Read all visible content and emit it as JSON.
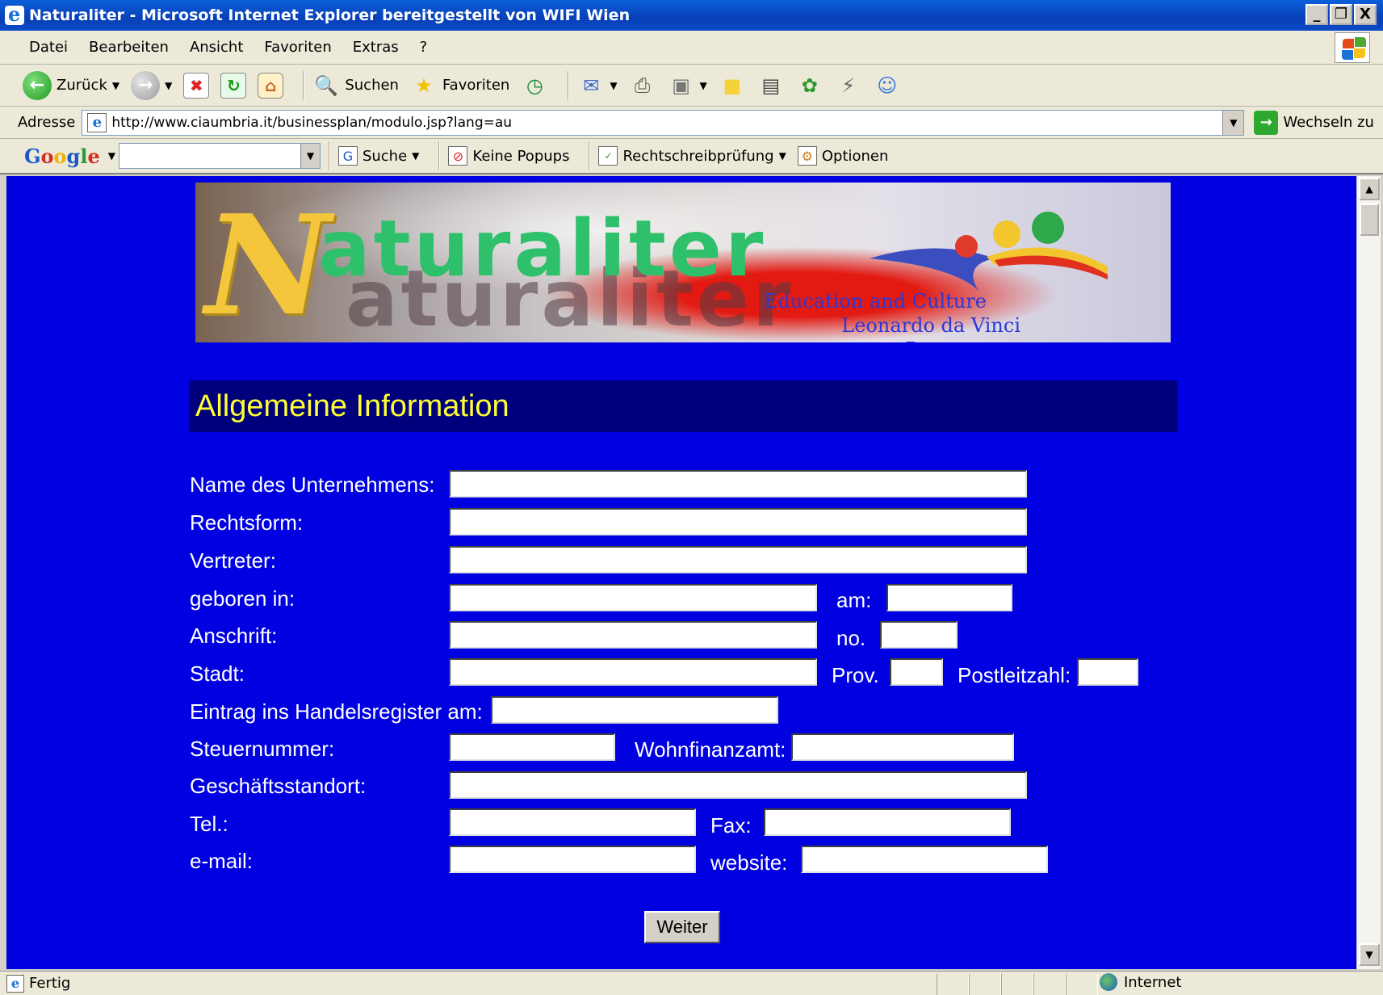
{
  "window": {
    "title": "Naturaliter - Microsoft Internet Explorer bereitgestellt von WIFI Wien",
    "buttons": [
      "_",
      "❐",
      "X"
    ]
  },
  "menu": [
    "Datei",
    "Bearbeiten",
    "Ansicht",
    "Favoriten",
    "Extras",
    "?"
  ],
  "toolbar": {
    "back_label": "Zurück",
    "search_label": "Suchen",
    "favorites_label": "Favoriten"
  },
  "address": {
    "label": "Adresse",
    "url": "http://www.ciaumbria.it/businessplan/modulo.jsp?lang=au",
    "go_label": "Wechseln zu"
  },
  "google_toolbar": {
    "logo": [
      "G",
      "o",
      "o",
      "g",
      "l",
      "e"
    ],
    "search_label": "Suche",
    "popups_label": "Keine Popups",
    "spellcheck_label": "Rechtschreibprüfung",
    "options_label": "Optionen"
  },
  "banner": {
    "logo_initial": "N",
    "logo_word": "aturaliter",
    "line1": "Education and Culture",
    "line2": "Leonardo da Vinci Programme"
  },
  "page": {
    "heading": "Allgemeine Information",
    "labels": {
      "company": "Name des Unternehmens:",
      "legal_form": "Rechtsform:",
      "representative": "Vertreter:",
      "born_in": "geboren in:",
      "born_on": "am:",
      "address": "Anschrift:",
      "number": "no.",
      "city": "Stadt:",
      "province": "Prov.",
      "postal_code": "Postleitzahl:",
      "register": "Eintrag ins Handelsregister am:",
      "tax_number": "Steuernummer:",
      "tax_office": "Wohnfinanzamt:",
      "location": "Geschäftsstandort:",
      "phone": "Tel.:",
      "fax": "Fax:",
      "email": "e-mail:",
      "website": "website:"
    },
    "submit_label": "Weiter"
  },
  "status": {
    "text": "Fertig",
    "zone": "Internet"
  },
  "colors": {
    "page_background": "#0000e1",
    "heading_background": "#00007c",
    "heading_text": "#ffff33",
    "label_text": "#ffffff"
  }
}
